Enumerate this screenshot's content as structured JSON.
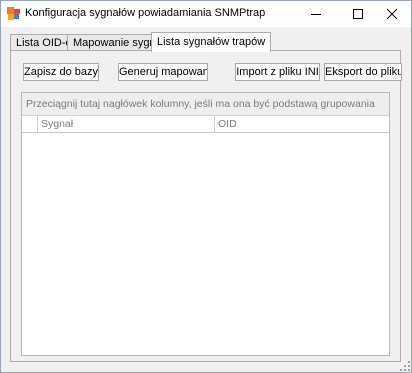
{
  "window": {
    "title": "Konfiguracja sygnałów powiadamiania SNMPtrap",
    "minimize_icon": "minimize-icon",
    "maximize_icon": "maximize-icon",
    "close_icon": "close-icon"
  },
  "tabs": [
    {
      "label": "Lista OID-ów",
      "active": false
    },
    {
      "label": "Mapowanie sygnałów",
      "active": false
    },
    {
      "label": "Lista sygnałów trapów",
      "active": true
    }
  ],
  "toolbar": {
    "save_label": "Zapisz do bazy",
    "generate_label": "Generuj mapowanie",
    "import_label": "Import z pliku INI",
    "export_label": "Eksport do pliku INI"
  },
  "grid": {
    "group_hint": "Przeciągnij tutaj nagłówek kolumny, jeśli ma ona być podstawą grupowania",
    "columns": [
      "Sygnał",
      "OID"
    ],
    "rows": []
  }
}
